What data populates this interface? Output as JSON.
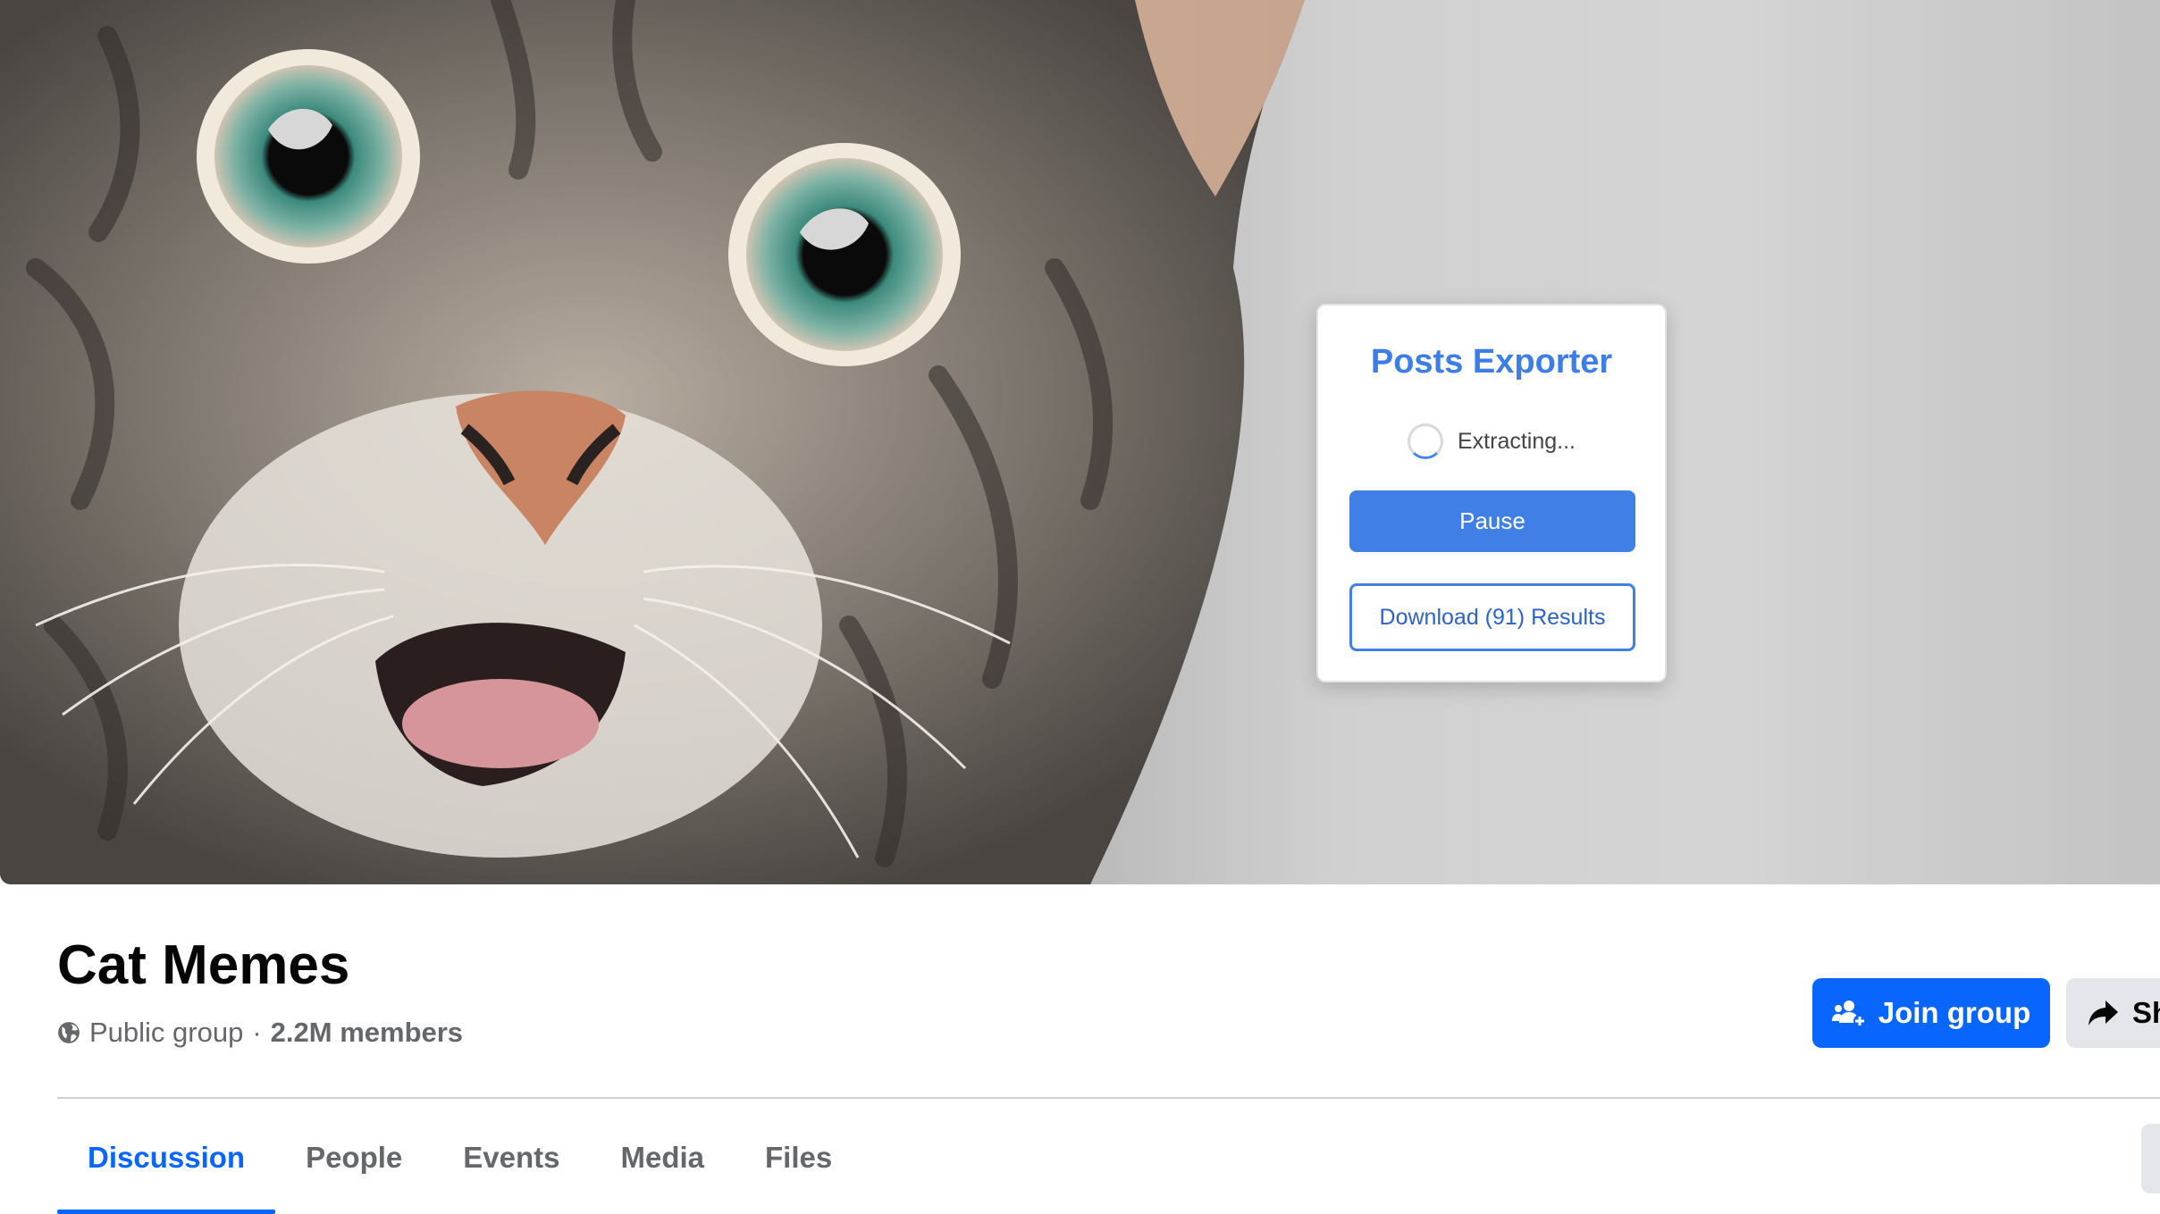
{
  "cover": {
    "image": "cat-photo"
  },
  "exporter": {
    "title": "Posts Exporter",
    "status": "Extracting...",
    "pause_label": "Pause",
    "download_label": "Download (91) Results",
    "accent_color": "#3f7fe6"
  },
  "group": {
    "name": "Cat Memes",
    "privacy": "Public group",
    "separator": "·",
    "members": "2.2M members",
    "join_label": "Join group",
    "share_label": "Sh"
  },
  "tabs": [
    "Discussion",
    "People",
    "Events",
    "Media",
    "Files"
  ],
  "colors": {
    "brand_blue": "#0866ff",
    "muted_text": "#65676b"
  }
}
